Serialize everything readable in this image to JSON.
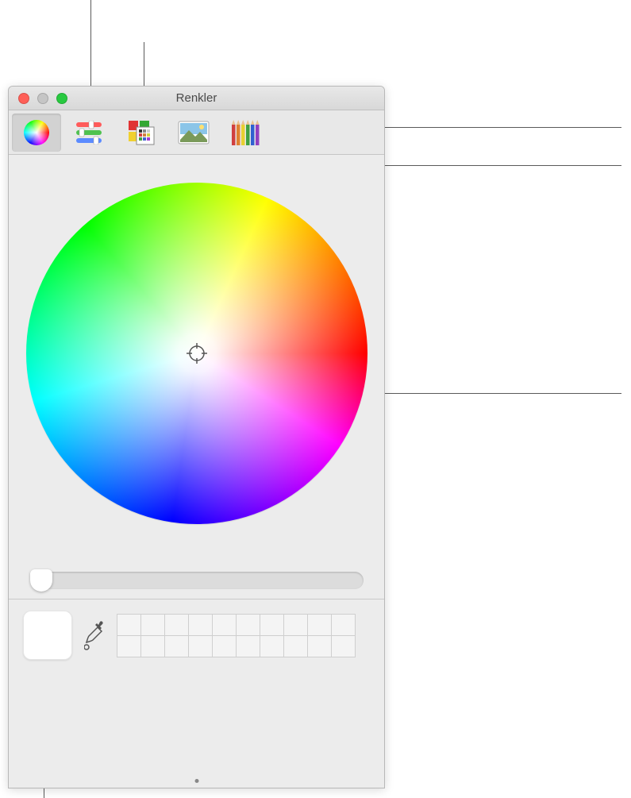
{
  "window": {
    "title": "Renkler"
  },
  "toolbar": {
    "tabs": [
      {
        "name": "color-wheel",
        "selected": true
      },
      {
        "name": "color-sliders",
        "selected": false
      },
      {
        "name": "color-palettes",
        "selected": false
      },
      {
        "name": "image-palettes",
        "selected": false
      },
      {
        "name": "pencils",
        "selected": false
      }
    ]
  },
  "brightness_slider": {
    "value": 0
  },
  "current_color": "#ffffff",
  "swatches": {
    "rows": 2,
    "cols": 10
  }
}
